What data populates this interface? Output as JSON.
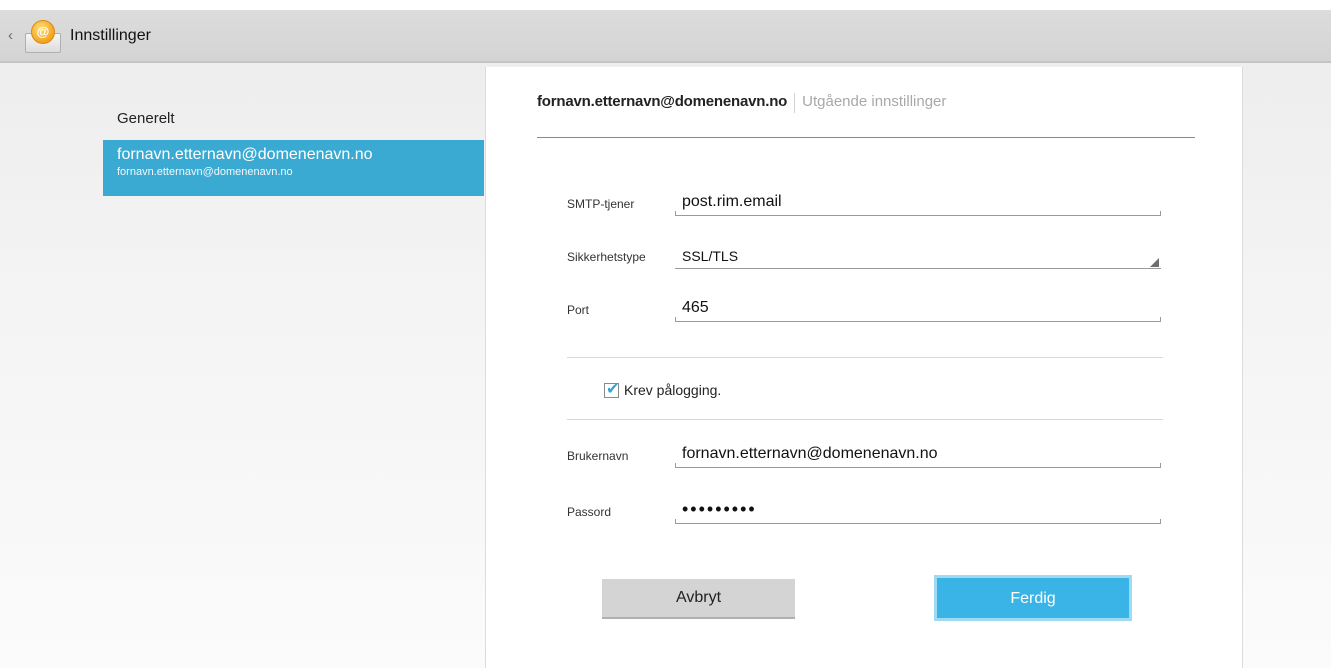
{
  "header": {
    "back_glyph": "‹",
    "app_icon": "email-app-icon",
    "app_icon_glyph": "@",
    "title": "Innstillinger"
  },
  "sidebar": {
    "items": [
      {
        "label": "Generelt",
        "selected": false
      },
      {
        "label": "fornavn.etternavn@domenenavn.no",
        "sublabel": "fornavn.etternavn@domenenavn.no",
        "selected": true
      }
    ],
    "selected_color": "#3aaad3"
  },
  "panel": {
    "account": "fornavn.etternavn@domenenavn.no",
    "subtitle": "Utgående innstillinger",
    "fields": {
      "smtp": {
        "label": "SMTP-tjener",
        "value": "post.rim.email"
      },
      "security": {
        "label": "Sikkerhetstype",
        "value": "SSL/TLS"
      },
      "port": {
        "label": "Port",
        "value": "465"
      },
      "username": {
        "label": "Brukernavn",
        "value": "fornavn.etternavn@domenenavn.no"
      },
      "password": {
        "label": "Passord",
        "value": "•••••••••"
      }
    },
    "require_login": {
      "label": "Krev pålogging.",
      "checked": true,
      "check_glyph": "✔"
    },
    "buttons": {
      "cancel": "Avbryt",
      "done": "Ferdig"
    },
    "accent_color": "#3ab4e6"
  }
}
